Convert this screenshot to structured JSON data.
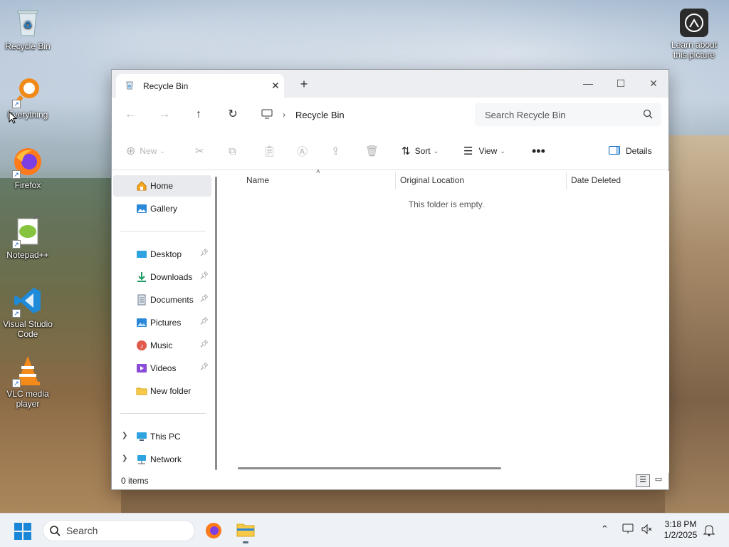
{
  "desktop": {
    "icons": [
      {
        "label": "Recycle Bin"
      },
      {
        "label": "Everything"
      },
      {
        "label": "Firefox"
      },
      {
        "label": "Notepad++"
      },
      {
        "label": "Visual Studio Code"
      },
      {
        "label": "VLC media player"
      }
    ],
    "learn_about": "Learn about this picture"
  },
  "window": {
    "tab_title": "Recycle Bin",
    "breadcrumb": "Recycle Bin",
    "search_placeholder": "Search Recycle Bin",
    "toolbar": {
      "new_label": "New",
      "sort_label": "Sort",
      "view_label": "View",
      "details_label": "Details"
    },
    "nav": {
      "home": "Home",
      "gallery": "Gallery",
      "desktop": "Desktop",
      "downloads": "Downloads",
      "documents": "Documents",
      "pictures": "Pictures",
      "music": "Music",
      "videos": "Videos",
      "new_folder": "New folder",
      "this_pc": "This PC",
      "network": "Network"
    },
    "columns": {
      "name": "Name",
      "original_location": "Original Location",
      "date_deleted": "Date Deleted"
    },
    "empty_message": "This folder is empty.",
    "status": "0 items"
  },
  "taskbar": {
    "search_label": "Search",
    "time": "3:18 PM",
    "date": "1/2/2025"
  },
  "colors": {
    "accent": "#0067c0",
    "selection": "#e8eaee"
  }
}
